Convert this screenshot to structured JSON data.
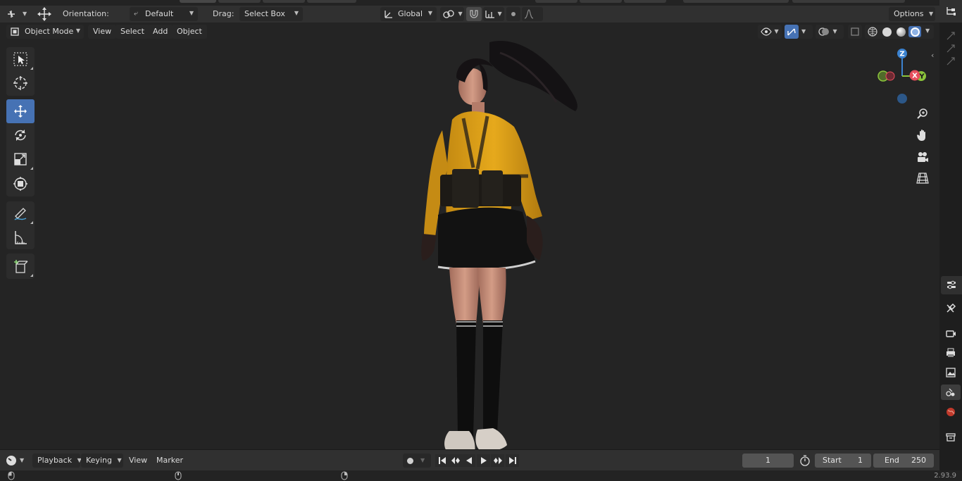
{
  "header": {
    "orientation_label": "Orientation:",
    "orientation_value": "Default",
    "drag_label": "Drag:",
    "drag_value": "Select Box",
    "transform_space": "Global",
    "options_label": "Options"
  },
  "viewport_header": {
    "mode": "Object Mode",
    "menus": [
      "View",
      "Select",
      "Add",
      "Object"
    ]
  },
  "gizmo": {
    "axes": [
      "Z",
      "X",
      "Y"
    ],
    "colors": {
      "x": "#e64e5c",
      "y": "#8bc43b",
      "z": "#3b82cf",
      "neg_x": "#6e2a33",
      "neg_y": "#506b2a",
      "neg_z": "#2c5788"
    }
  },
  "toolbar": {
    "tools": [
      "select-box",
      "cursor",
      "move",
      "rotate",
      "scale",
      "transform",
      "annotate",
      "measure",
      "add-cube"
    ],
    "active_tool": "move",
    "accent": "#4672b4"
  },
  "timeline": {
    "menus": [
      "Playback",
      "Keying",
      "View",
      "Marker"
    ],
    "current_frame": "1",
    "start_label": "Start",
    "start_value": "1",
    "end_label": "End",
    "end_value": "250"
  },
  "status": {
    "version": "2.93.9"
  }
}
